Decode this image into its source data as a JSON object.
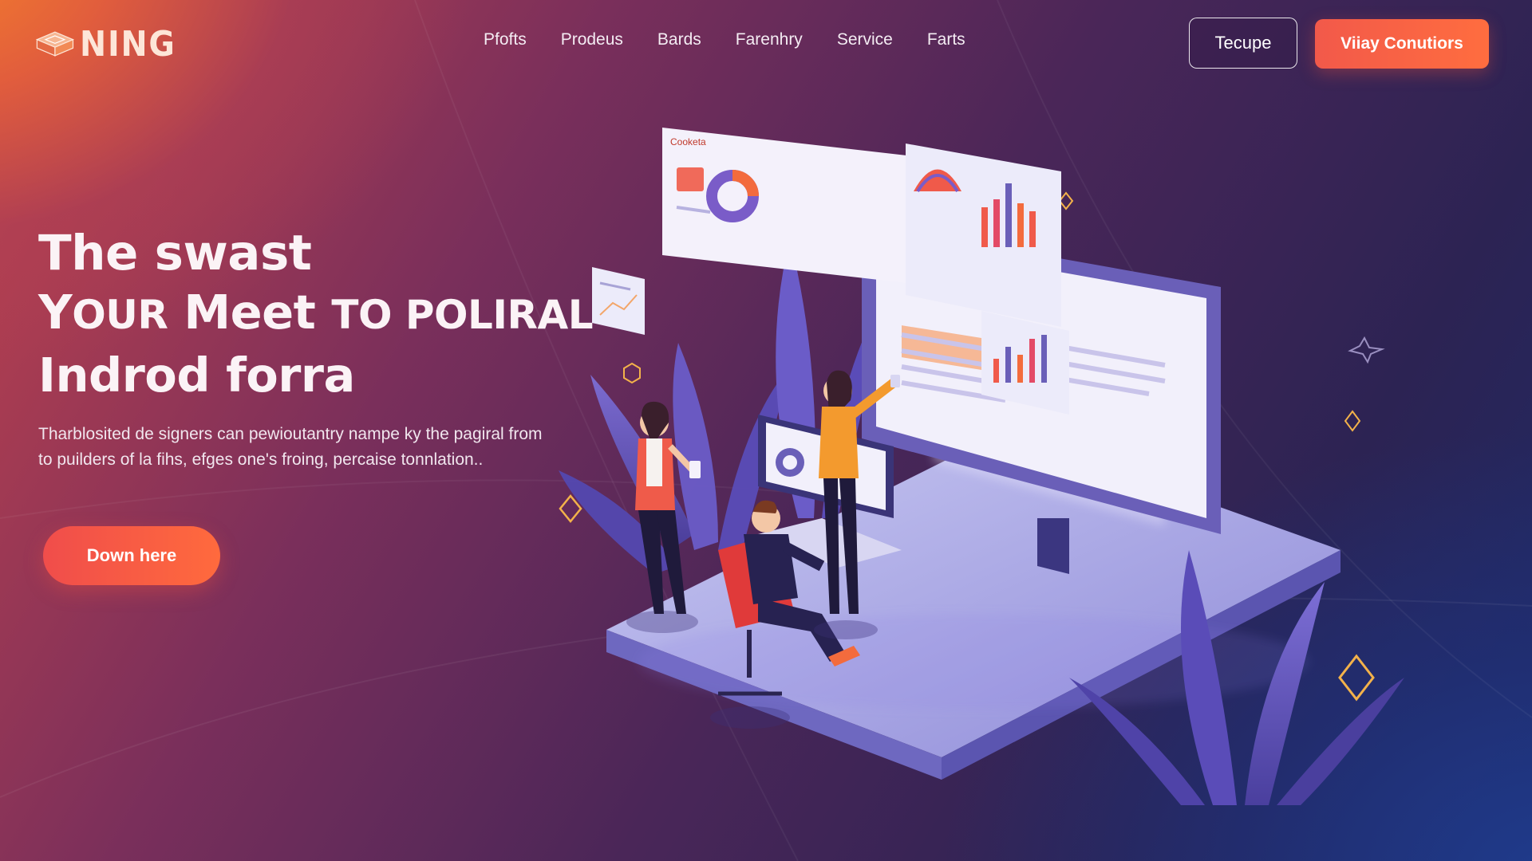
{
  "brand": {
    "name": "NING"
  },
  "nav": {
    "links": [
      "Pfofts",
      "Prodeus",
      "Bards",
      "Farenhry",
      "Service",
      "Farts"
    ]
  },
  "header_actions": {
    "outline_label": "Tecupe",
    "primary_label": "Viiay Conutiors"
  },
  "hero": {
    "line1": "The swast",
    "line2_a": "Y",
    "line2_b": "OUR",
    "line2_c": " Meet ",
    "line2_d": "TO POLIRAL",
    "line3": "Indrod forra",
    "description": "Tharblosited de signers can pewioutantry nampe ky the pagiral from to puilders of la fihs, efges one's froing, percaise tonnlation..",
    "cta_label": "Down here"
  },
  "illustration": {
    "panel_title": "Cooketa"
  },
  "colors": {
    "accent": "#f2594a",
    "accent_gold": "#f3b24a",
    "bg_deep": "#2c2353",
    "panel_purple": "#6c5fb5"
  }
}
